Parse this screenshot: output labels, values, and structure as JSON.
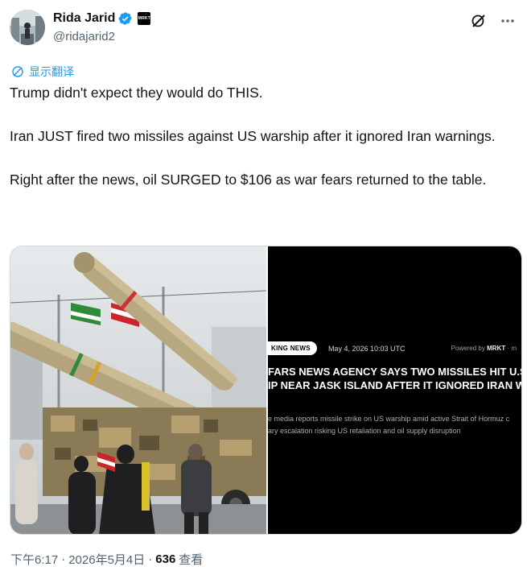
{
  "author": {
    "display_name": "Rida Jarid",
    "handle": "@ridajarid2",
    "affiliation_badge": "MRKT",
    "verified_icon": "verified-badge-icon",
    "colors": {
      "verified": "#1d9bf0",
      "name": "#0f1419",
      "handle": "#536471"
    }
  },
  "translate": {
    "label": "显示翻译",
    "icon": "globe-translate-icon",
    "color": "#1d9bf0"
  },
  "tweet": {
    "paragraphs": [
      "Trump didn't expect they would do THIS.",
      "Iran JUST fired two missiles against US warship after it ignored Iran warnings.",
      "Right after the news, oil SURGED to $106 as war fears returned to the table."
    ]
  },
  "media": {
    "left_photo": {
      "icon": "missile-photo"
    },
    "news_card": {
      "tag": "KING NEWS",
      "date": "May 4, 2026 10:03 UTC",
      "powered_prefix": "Powered by",
      "powered_brand": "MRKT",
      "powered_suffix": "· m",
      "headline_line1": "FARS NEWS AGENCY SAYS TWO MISSILES HIT U.S.",
      "headline_line2": "IP NEAR JASK ISLAND AFTER IT IGNORED IRAN WAR",
      "sub_line1": "e media reports missile strike on US warship amid active Strait of Hormuz c",
      "sub_line2": "ary escalation risking US retaliation and oil supply disruption"
    }
  },
  "footer": {
    "time": "下午6:17",
    "sep1": "·",
    "date": "2026年5月4日",
    "sep2": "·",
    "views_count": "636",
    "views_label": "查看"
  },
  "top_icons": [
    "grok-slash-icon",
    "more-options-icon"
  ]
}
